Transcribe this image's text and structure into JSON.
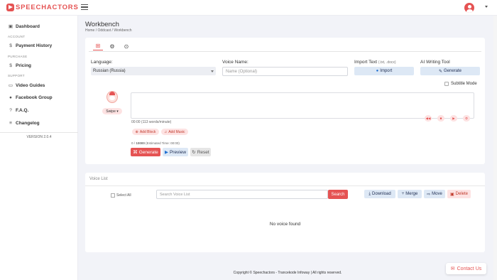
{
  "app": {
    "logo_text": "SPEECHACTORS"
  },
  "sidebar": {
    "items": [
      {
        "icon": "▣",
        "label": "Dashboard"
      },
      {
        "icon": "$",
        "label": "Payment History"
      },
      {
        "icon": "$",
        "label": "Pricing"
      },
      {
        "icon": "▭",
        "label": "Video Guides"
      },
      {
        "icon": "●",
        "label": "Facebook Group"
      },
      {
        "icon": "?",
        "label": "F.A.Q."
      },
      {
        "icon": "≡",
        "label": "Changelog"
      }
    ],
    "sections": [
      "ACCOUNT",
      "PURCHASE",
      "SUPPORT"
    ],
    "version": "VERSION 2.0.4"
  },
  "page": {
    "title": "Workbench",
    "breadcrumb": {
      "home": "Home",
      "sep": "/",
      "project": "Oddcast",
      "current": "Workbench"
    }
  },
  "workbench": {
    "language_label": "Language:",
    "language_value": "Russian (Russia)",
    "voice_name_label": "Voice Name:",
    "voice_name_placeholder": "Name (Optional)",
    "import_label": "Import Text",
    "import_hint": "(.txt, .docx)",
    "import_button": "Import",
    "ai_label": "AI Writing Tool",
    "ai_button": "Generate",
    "subtitle_mode": "Subtitle Mode",
    "swipe": "Swipe ▾",
    "stats": "00:00 (113 words/minute)",
    "add_block": "Add Block",
    "add_music": "Add Music",
    "chars_used": "0",
    "chars_sep": "/",
    "chars_limit": "10000",
    "estimated": "(Estimated Time: 00:00)",
    "generate_button": "Generate",
    "preview_button": "Preview",
    "reset_button": "Reset"
  },
  "voice_list": {
    "title": "Voice List",
    "select_all": "Select All",
    "search_placeholder": "Search Voice List",
    "search_button": "Search",
    "download_button": "Download",
    "merge_button": "Merge",
    "move_button": "Move",
    "delete_button": "Delete",
    "empty_text": "No voice found"
  },
  "footer": {
    "text": "Copyright © Speechactors - Trancekode Infoway | All rights reserved."
  },
  "contact": {
    "label": "Contact Us"
  },
  "colors": {
    "accent": "#e55353",
    "button_light": "#dde8f5",
    "background": "#f2f3f8"
  }
}
